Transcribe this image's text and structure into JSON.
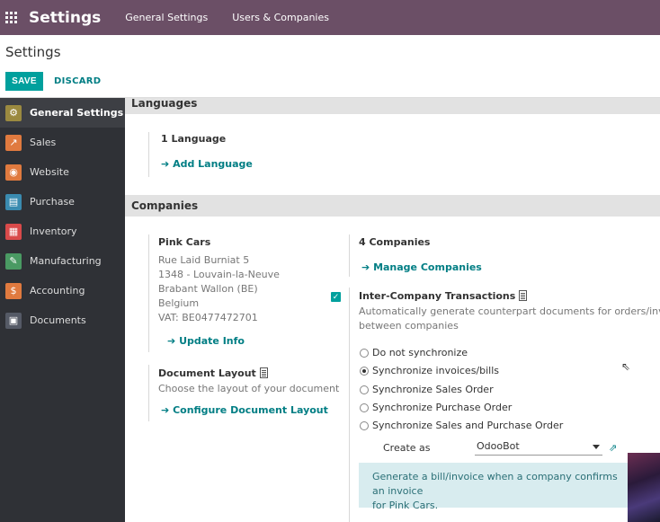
{
  "topbar": {
    "brand": "Settings",
    "menu": [
      "General Settings",
      "Users & Companies"
    ]
  },
  "control": {
    "title": "Settings",
    "save_label": "SAVE",
    "discard_label": "DISCARD"
  },
  "sidebar": {
    "items": [
      {
        "label": "General Settings",
        "icon": "gear-icon",
        "color": "#9b8a40",
        "glyph": "⚙"
      },
      {
        "label": "Sales",
        "icon": "chart-icon",
        "color": "#e07a3f",
        "glyph": "↗"
      },
      {
        "label": "Website",
        "icon": "globe-icon",
        "color": "#e07a3f",
        "glyph": "◉"
      },
      {
        "label": "Purchase",
        "icon": "cart-icon",
        "color": "#3a8bb0",
        "glyph": "▤"
      },
      {
        "label": "Inventory",
        "icon": "box-icon",
        "color": "#d94a4a",
        "glyph": "▦"
      },
      {
        "label": "Manufacturing",
        "icon": "wrench-icon",
        "color": "#4a9a63",
        "glyph": "✎"
      },
      {
        "label": "Accounting",
        "icon": "invoice-icon",
        "color": "#e07a3f",
        "glyph": "$"
      },
      {
        "label": "Documents",
        "icon": "folder-icon",
        "color": "#555a66",
        "glyph": "▣"
      }
    ]
  },
  "languages": {
    "header": "Languages",
    "count": "1 Language",
    "add_link": "Add Language"
  },
  "companies": {
    "header": "Companies",
    "company_name": "Pink Cars",
    "address_lines": [
      "Rue Laid Burniat 5",
      "1348 - Louvain-la-Neuve",
      "Brabant Wallon (BE)",
      "Belgium",
      "VAT: BE0477472701"
    ],
    "update_link": "Update Info",
    "count": "4 Companies",
    "manage_link": "Manage Companies",
    "doc_layout_title": "Document Layout",
    "doc_layout_desc": "Choose the layout of your document",
    "configure_link": "Configure Document Layout",
    "intercompany_title": "Inter-Company Transactions",
    "intercompany_desc_1": "Automatically generate counterpart documents for orders/invoices",
    "intercompany_desc_2": "between companies",
    "radio_options": [
      "Do not synchronize",
      "Synchronize invoices/bills",
      "Synchronize Sales Order",
      "Synchronize Purchase Order",
      "Synchronize Sales and Purchase Order"
    ],
    "create_as_label": "Create as",
    "create_as_value": "OdooBot",
    "alert_line_1": "Generate a bill/invoice when a company confirms an invoice",
    "alert_line_2": "for Pink Cars."
  },
  "colors": {
    "topbar": "#6b4f66",
    "primary": "#00a09d",
    "link": "#017e84"
  }
}
